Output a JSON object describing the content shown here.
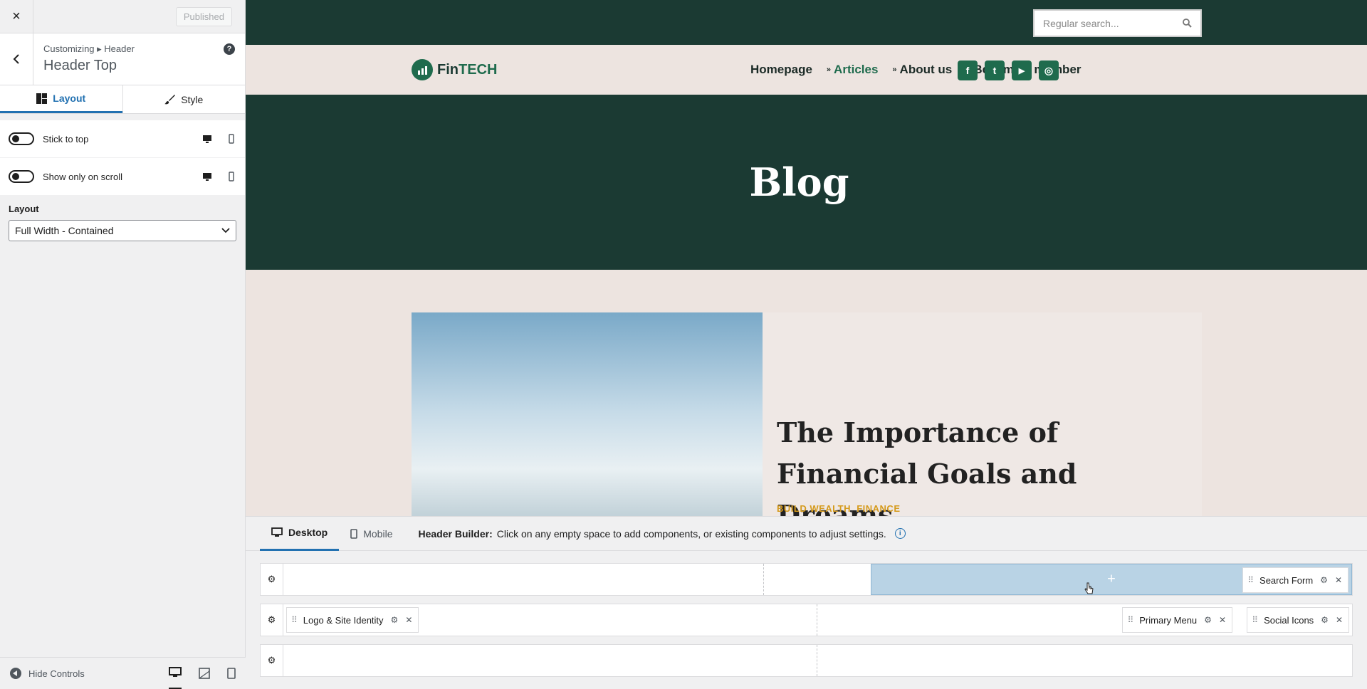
{
  "sidebar": {
    "close_label": "×",
    "publish_label": "Published",
    "breadcrumb": "Customizing ▸ Header",
    "section_title": "Header Top",
    "help_label": "?",
    "tabs": [
      {
        "label": "Layout"
      },
      {
        "label": "Style"
      }
    ],
    "options": [
      {
        "label": "Stick to top"
      },
      {
        "label": "Show only on scroll"
      }
    ],
    "layout_label": "Layout",
    "layout_value": "Full Width - Contained",
    "hide_controls_label": "Hide Controls"
  },
  "preview": {
    "search_placeholder": "Regular search...",
    "logo_text_a": "Fin",
    "logo_text_b": "TECH",
    "menu": [
      {
        "label": "Homepage",
        "caret": ""
      },
      {
        "label": "Articles",
        "caret": "»"
      },
      {
        "label": "About us",
        "caret": "»"
      },
      {
        "label": "Become a member",
        "caret": "»"
      }
    ],
    "socials": [
      {
        "icon": "facebook-icon",
        "glyph": "f"
      },
      {
        "icon": "twitter-icon",
        "glyph": "t"
      },
      {
        "icon": "youtube-icon",
        "glyph": "▶"
      },
      {
        "icon": "instagram-icon",
        "glyph": "◎"
      }
    ],
    "hero_title": "Blog",
    "post_title": "The Importance of Financial Goals and Dreams",
    "post_cat_1": "BUILD WEALTH",
    "post_cat_sep": ",",
    "post_cat_2": "FINANCE",
    "colors": {
      "dark_green": "#1b3a33",
      "brand_green": "#1f6b4d",
      "accent_gold": "#d59a1c",
      "beige": "#ede4e0"
    }
  },
  "builder": {
    "tabs": [
      {
        "label": "Desktop"
      },
      {
        "label": "Mobile"
      }
    ],
    "help_bold": "Header Builder:",
    "help_text": "Click on any empty space to add components, or existing components to adjust settings.",
    "info_label": "i",
    "plus_label": "+",
    "components": {
      "search_form": "Search Form",
      "logo": "Logo & Site Identity",
      "primary_menu": "Primary Menu",
      "social_icons": "Social Icons"
    }
  }
}
